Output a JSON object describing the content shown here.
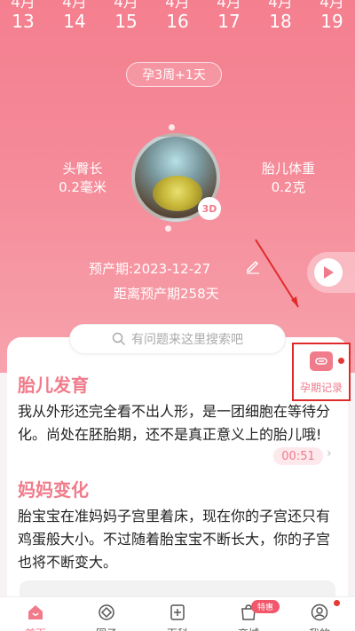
{
  "date_strip": [
    {
      "month": "4月",
      "day": "13"
    },
    {
      "month": "4月",
      "day": "14"
    },
    {
      "month": "4月",
      "day": "15"
    },
    {
      "month": "4月",
      "day": "16"
    },
    {
      "month": "4月",
      "day": "17"
    },
    {
      "month": "4月",
      "day": "18"
    },
    {
      "month": "4月",
      "day": "19"
    }
  ],
  "week_label": "孕3周+1天",
  "metrics": {
    "head_hip": {
      "label": "头臀长",
      "value": "0.2毫米"
    },
    "weight": {
      "label": "胎儿体重",
      "value": "0.2克"
    }
  },
  "badge_3d": "3D",
  "due_date": "预产期:2023-12-27",
  "countdown": "距离预产期258天",
  "search_placeholder": "有问题来这里搜索吧",
  "record_label": "孕期记录",
  "sections": {
    "fetal": {
      "title": "胎儿发育",
      "text": "我从外形还完全看不出人形，是一团细胞在等待分化。尚处在胚胎期，还不是真正意义上的胎儿哦!",
      "audio_time": "00:51"
    },
    "mother": {
      "title": "妈妈变化",
      "text": "胎宝宝在准妈妈子宫里着床，现在你的子宫还只有鸡蛋般大小。不过随着胎宝宝不断长大，你的子宫也将不断变大。"
    }
  },
  "tabs": [
    {
      "label": "首页",
      "icon": "home-icon"
    },
    {
      "label": "圈子",
      "icon": "circle-icon"
    },
    {
      "label": "百科",
      "icon": "encyclopedia-icon"
    },
    {
      "label": "商城",
      "icon": "shop-icon"
    },
    {
      "label": "我的",
      "icon": "profile-icon"
    }
  ],
  "hot_badge": "特惠",
  "colors": {
    "accent": "#f07b8b",
    "hero_top": "#f47f8f",
    "annotation_red": "#e02a2a"
  }
}
